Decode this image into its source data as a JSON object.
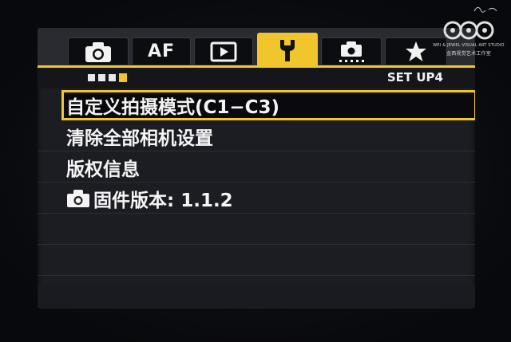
{
  "tabs": [
    {
      "id": "shooting",
      "label": "",
      "icon": "camera-icon",
      "active": false
    },
    {
      "id": "af",
      "label": "AF",
      "icon": "",
      "active": false
    },
    {
      "id": "playback",
      "label": "",
      "icon": "play-icon",
      "active": false
    },
    {
      "id": "setup",
      "label": "",
      "icon": "wrench-icon",
      "active": true
    },
    {
      "id": "live-view",
      "label": "",
      "icon": "camera-dots-icon",
      "active": false
    },
    {
      "id": "my-menu",
      "label": "",
      "icon": "star-icon",
      "active": false
    }
  ],
  "page_indicator": {
    "total": 4,
    "current": 4
  },
  "section_title": "SET UP4",
  "menu_items": [
    {
      "label": "自定义拍摄模式(C1−C3)",
      "selected": true
    },
    {
      "label": "清除全部相机设置",
      "selected": false
    },
    {
      "label": "版权信息",
      "selected": false
    },
    {
      "label": "固件版本: 1.1.2",
      "selected": false,
      "icon": "camera-icon"
    }
  ],
  "watermark": {
    "signature": "",
    "line1": "WEI & JEWEL VISUAL ART STUDIO",
    "line2": "金西视觉艺术工作室"
  },
  "colors": {
    "accent": "#f1c62c",
    "background": "#1c1d22",
    "text": "#f4f4f4"
  }
}
